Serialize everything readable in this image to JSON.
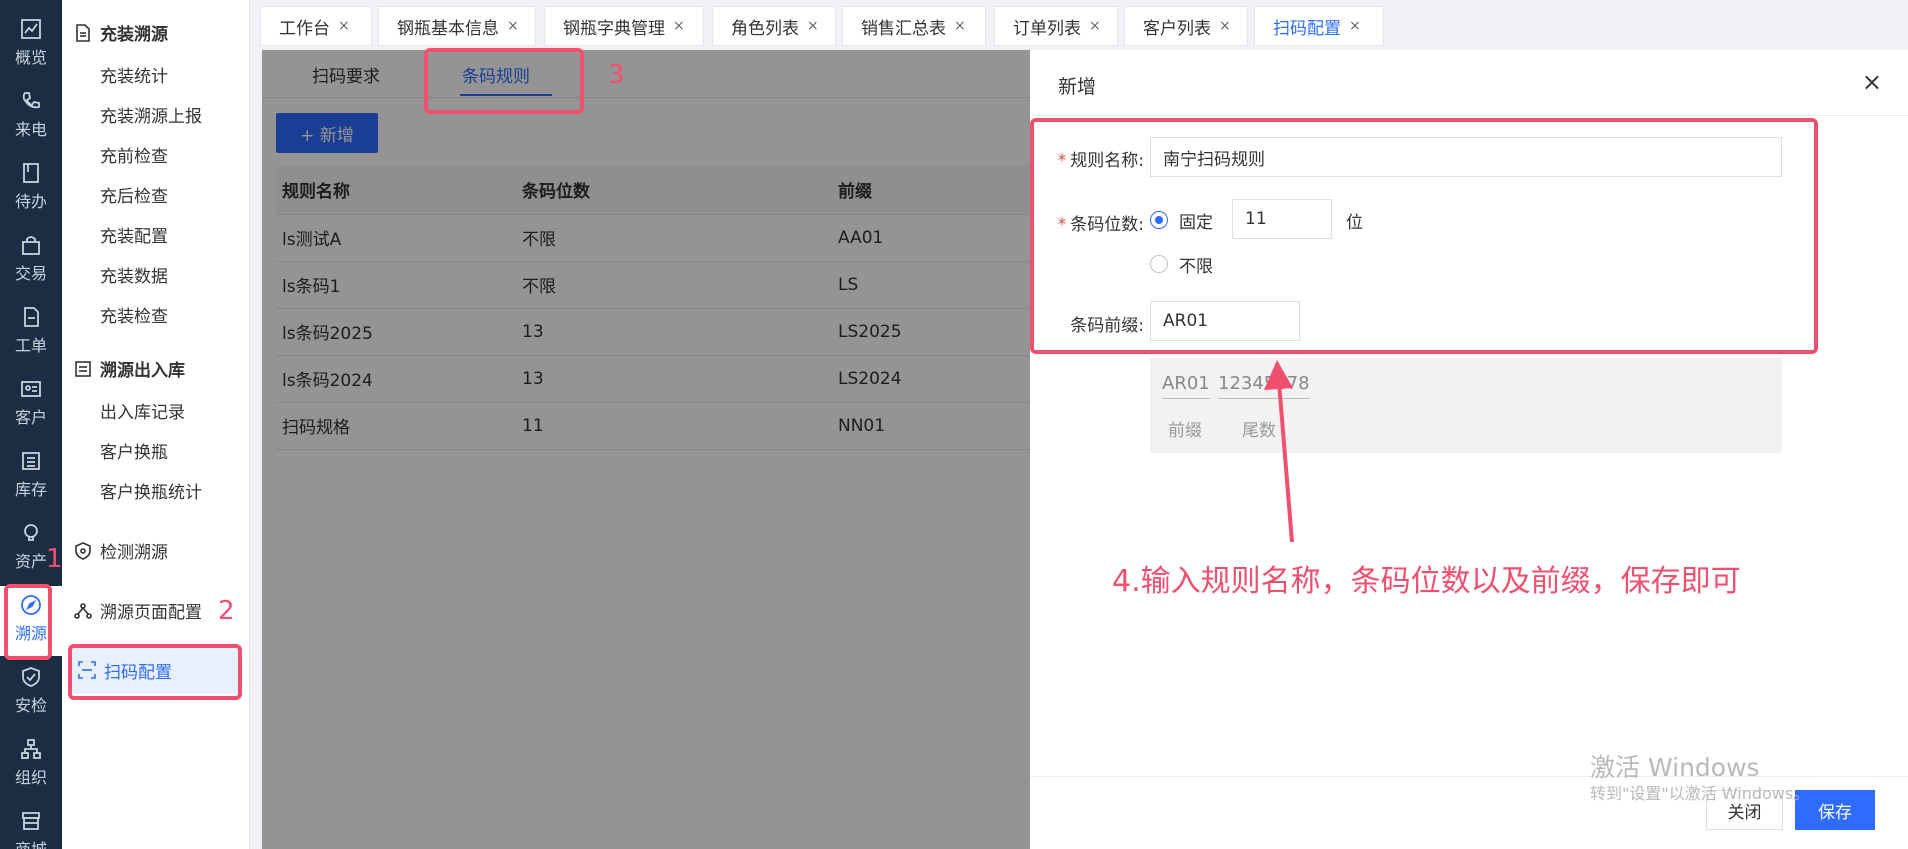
{
  "rail": {
    "items": [
      {
        "label": "概览",
        "icon": "chart-icon"
      },
      {
        "label": "来电",
        "icon": "phone-icon"
      },
      {
        "label": "待办",
        "icon": "todo-icon"
      },
      {
        "label": "交易",
        "icon": "bag-icon"
      },
      {
        "label": "工单",
        "icon": "document-icon"
      },
      {
        "label": "客户",
        "icon": "id-card-icon"
      },
      {
        "label": "库存",
        "icon": "list-icon"
      },
      {
        "label": "资产",
        "icon": "bulb-icon"
      },
      {
        "label": "溯源",
        "icon": "compass-icon"
      },
      {
        "label": "安检",
        "icon": "shield-check-icon"
      },
      {
        "label": "组织",
        "icon": "org-icon"
      },
      {
        "label": "商城",
        "icon": "store-icon"
      }
    ]
  },
  "menu": {
    "group1": "充装溯源",
    "group1_items": [
      "充装统计",
      "充装溯源上报",
      "充前检查",
      "充后检查",
      "充装配置",
      "充装数据",
      "充装检查"
    ],
    "group2": "溯源出入库",
    "group2_items": [
      "出入库记录",
      "客户换瓶",
      "客户换瓶统计"
    ],
    "item_detect": "检测溯源",
    "item_page_config": "溯源页面配置",
    "item_scan_config": "扫码配置"
  },
  "tabs": [
    {
      "label": "工作台"
    },
    {
      "label": "钢瓶基本信息"
    },
    {
      "label": "钢瓶字典管理"
    },
    {
      "label": "角色列表"
    },
    {
      "label": "销售汇总表"
    },
    {
      "label": "订单列表"
    },
    {
      "label": "客户列表"
    },
    {
      "label": "扫码配置"
    }
  ],
  "tab_close": "×",
  "subtabs": {
    "scan_req": "扫码要求",
    "barcode_rule": "条码规则"
  },
  "add_button": "+ 新增",
  "table": {
    "headers": [
      "规则名称",
      "条码位数",
      "前缀"
    ],
    "rows": [
      [
        "ls测试A",
        "不限",
        "AA01"
      ],
      [
        "ls条码1",
        "不限",
        "LS"
      ],
      [
        "ls条码2025",
        "13",
        "LS2025"
      ],
      [
        "ls条码2024",
        "13",
        "LS2024"
      ],
      [
        "扫码规格",
        "11",
        "NN01"
      ]
    ]
  },
  "drawer": {
    "title": "新增",
    "close": "×",
    "rule_name_label": "规则名称:",
    "rule_name_value": "南宁扫码规则",
    "digits_label": "条码位数:",
    "fixed_label": "固定",
    "digits_value": "11",
    "digits_unit": "位",
    "unlimited_label": "不限",
    "prefix_label": "条码前缀:",
    "prefix_value": "AR01",
    "preview_prefix": "AR01",
    "preview_number": "12345678",
    "preview_prefix_label": "前缀",
    "preview_number_label": "尾数",
    "btn_close": "关闭",
    "btn_save": "保存"
  },
  "annotations": {
    "n1": "1",
    "n2": "2",
    "n3": "3",
    "note": "4.输入规则名称，条码位数以及前缀，保存即可"
  },
  "watermark": {
    "line1": "激活 Windows",
    "line2": "转到\"设置\"以激活 Windows。"
  },
  "colors": {
    "primary": "#2e6cff",
    "annotation": "#f0506e",
    "rail_bg": "#1b2d43"
  }
}
